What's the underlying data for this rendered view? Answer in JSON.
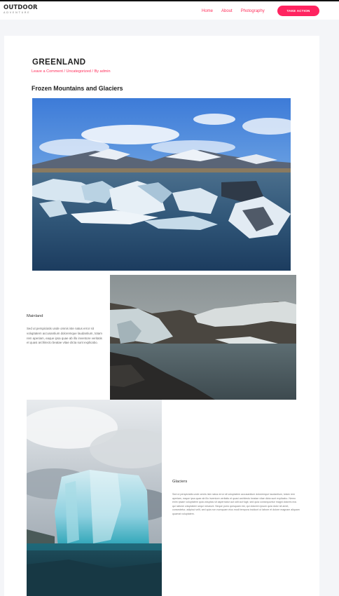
{
  "header": {
    "logo": {
      "main": "OUTDOOR",
      "sub": "ADVENTURE"
    },
    "nav": [
      "Home",
      "About",
      "Photography"
    ],
    "cta": "TAKE ACTION"
  },
  "post": {
    "title": "GREENLAND",
    "meta": "Leave a Comment / Uncategorized / By admin",
    "section_heading": "Frozen Mountains and Glaciers"
  },
  "mainland": {
    "title": "Mainland",
    "text": "Sed ut perspiciatis unde omnis iste natus error sit voluptatem accusantium doloremque laudantium, totam rem aperiam, eaque ipsa quae ab illo inventore veritatis et quasi architecto beatae vitae dicta sunt explicabo."
  },
  "glaciers": {
    "title": "Glaciers",
    "text": "Sed ut perspiciatis unde omnis iste natus error sit voluptatem accusantium doloremque laudantium, totam rem aperiam, eaque ipsa quae ab illo inventore veritatis et quasi architecto beatae vitae dicta sunt explicabo. Nemo enim ipsam voluptatem quia voluptas sit aspernatur aut odit aut fugit, sed quia consequuntur magni dolores eos qui ratione voluptatem sequi nesciunt. Neque porro quisquam est, qui dolorem ipsum quia dolor sit amet, consectetur, adipisci velit, sed quia non numquam eius modi tempora incidunt ut labore et dolore magnam aliquam quaerat voluptatem."
  },
  "colors": {
    "accent": "#ff2f5b",
    "cta_bg": "#ff2460",
    "page_bg": "#f4f5f8"
  }
}
